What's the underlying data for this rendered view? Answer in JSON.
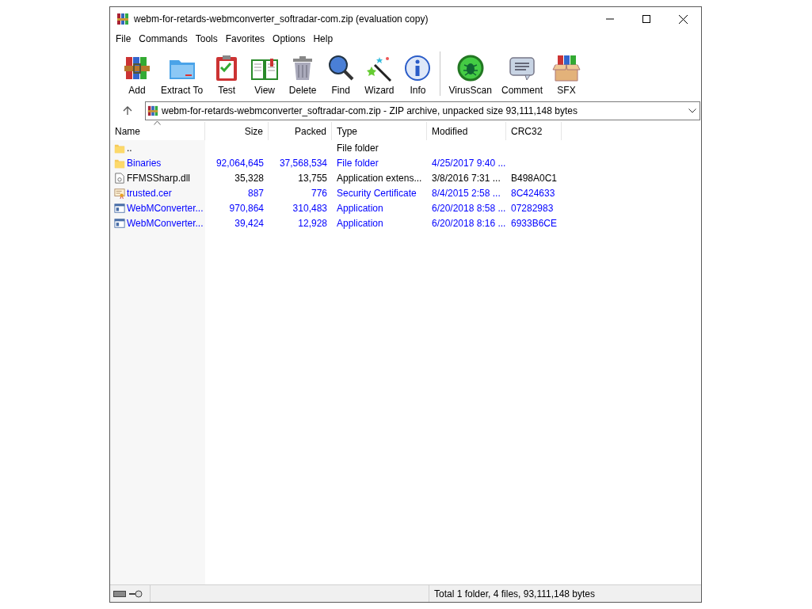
{
  "window": {
    "title": "webm-for-retards-webmconverter_softradar-com.zip (evaluation copy)"
  },
  "menu": [
    "File",
    "Commands",
    "Tools",
    "Favorites",
    "Options",
    "Help"
  ],
  "toolbar": [
    {
      "label": "Add",
      "kind": "add"
    },
    {
      "label": "Extract To",
      "kind": "extract"
    },
    {
      "label": "Test",
      "kind": "test"
    },
    {
      "label": "View",
      "kind": "view"
    },
    {
      "label": "Delete",
      "kind": "delete"
    },
    {
      "label": "Find",
      "kind": "find"
    },
    {
      "label": "Wizard",
      "kind": "wizard"
    },
    {
      "label": "Info",
      "kind": "info"
    },
    {
      "label": "VirusScan",
      "kind": "virusscan"
    },
    {
      "label": "Comment",
      "kind": "comment"
    },
    {
      "label": "SFX",
      "kind": "sfx"
    }
  ],
  "address": {
    "value": "webm-for-retards-webmconverter_softradar-com.zip - ZIP archive, unpacked size 93,111,148 bytes"
  },
  "table": {
    "columns": [
      "Name",
      "Size",
      "Packed",
      "Type",
      "Modified",
      "CRC32"
    ],
    "rows": [
      {
        "kind": "folder",
        "color": "#000000",
        "cells": [
          "..",
          "",
          "",
          "File folder",
          "",
          ""
        ]
      },
      {
        "kind": "folder",
        "color": "#0000ff",
        "cells": [
          "Binaries",
          "92,064,645",
          "37,568,534",
          "File folder",
          "4/25/2017 9:40 ...",
          ""
        ]
      },
      {
        "kind": "dll",
        "color": "#000000",
        "cells": [
          "FFMSSharp.dll",
          "35,328",
          "13,755",
          "Application extens...",
          "3/8/2016 7:31 ...",
          "B498A0C1"
        ]
      },
      {
        "kind": "certificate",
        "color": "#0000ff",
        "cells": [
          "trusted.cer",
          "887",
          "776",
          "Security Certificate",
          "8/4/2015 2:58 ...",
          "8C424633"
        ]
      },
      {
        "kind": "application",
        "color": "#0000ff",
        "cells": [
          "WebMConverter...",
          "970,864",
          "310,483",
          "Application",
          "6/20/2018 8:58 ...",
          "07282983"
        ]
      },
      {
        "kind": "application",
        "color": "#0000ff",
        "cells": [
          "WebMConverter...",
          "39,424",
          "12,928",
          "Application",
          "6/20/2018 8:16 ...",
          "6933B6CE"
        ]
      }
    ]
  },
  "status_bar": {
    "text": "Total 1 folder, 4 files, 93,111,148 bytes"
  }
}
